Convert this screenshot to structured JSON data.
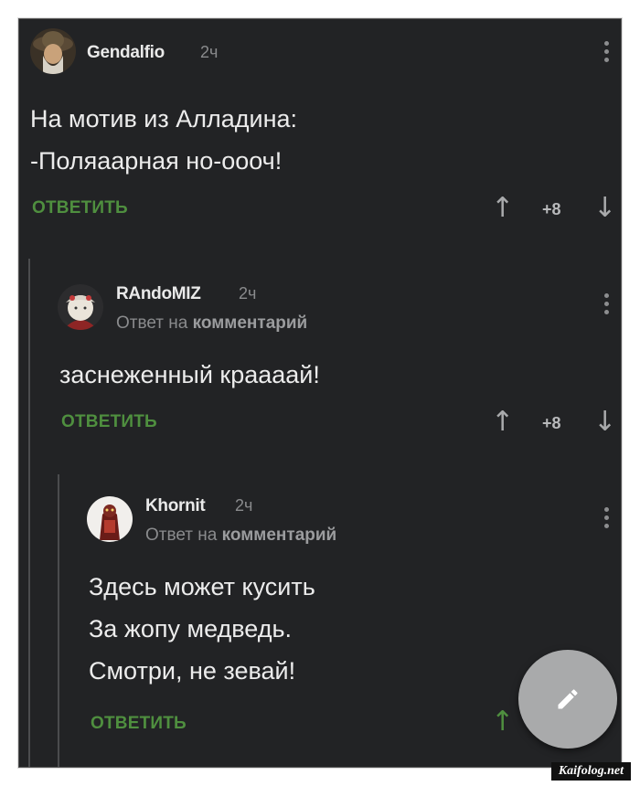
{
  "comments": [
    {
      "username": "Gendalfio",
      "time": "2ч",
      "reply_prefix": "",
      "reply_target": "",
      "lines": [
        "На мотив из Алладина:",
        "-Поляаарная но-оооч!"
      ],
      "reply_label": "ОТВЕТИТЬ",
      "score": "+8"
    },
    {
      "username": "RAndoMIZ",
      "time": "2ч",
      "reply_prefix": "Ответ на",
      "reply_target": "комментарий",
      "lines": [
        "заснеженный краааай!"
      ],
      "reply_label": "ОТВЕТИТЬ",
      "score": "+8"
    },
    {
      "username": "Khornit",
      "time": "2ч",
      "reply_prefix": "Ответ на",
      "reply_target": "комментарий",
      "lines": [
        "Здесь может кусить",
        "За жопу медведь.",
        "Смотри, не зевай!"
      ],
      "reply_label": "ОТВЕТИТЬ"
    }
  ],
  "icons": {
    "upvote": "arrow-up-icon",
    "downvote": "arrow-down-icon",
    "more": "more-vertical-icon",
    "fab": "pencil-icon"
  },
  "colors": {
    "background": "#222325",
    "accent_green": "#4f8f3f",
    "text": "#ececec",
    "muted": "#8a8b8d"
  },
  "watermark": "Kaifolog.net"
}
